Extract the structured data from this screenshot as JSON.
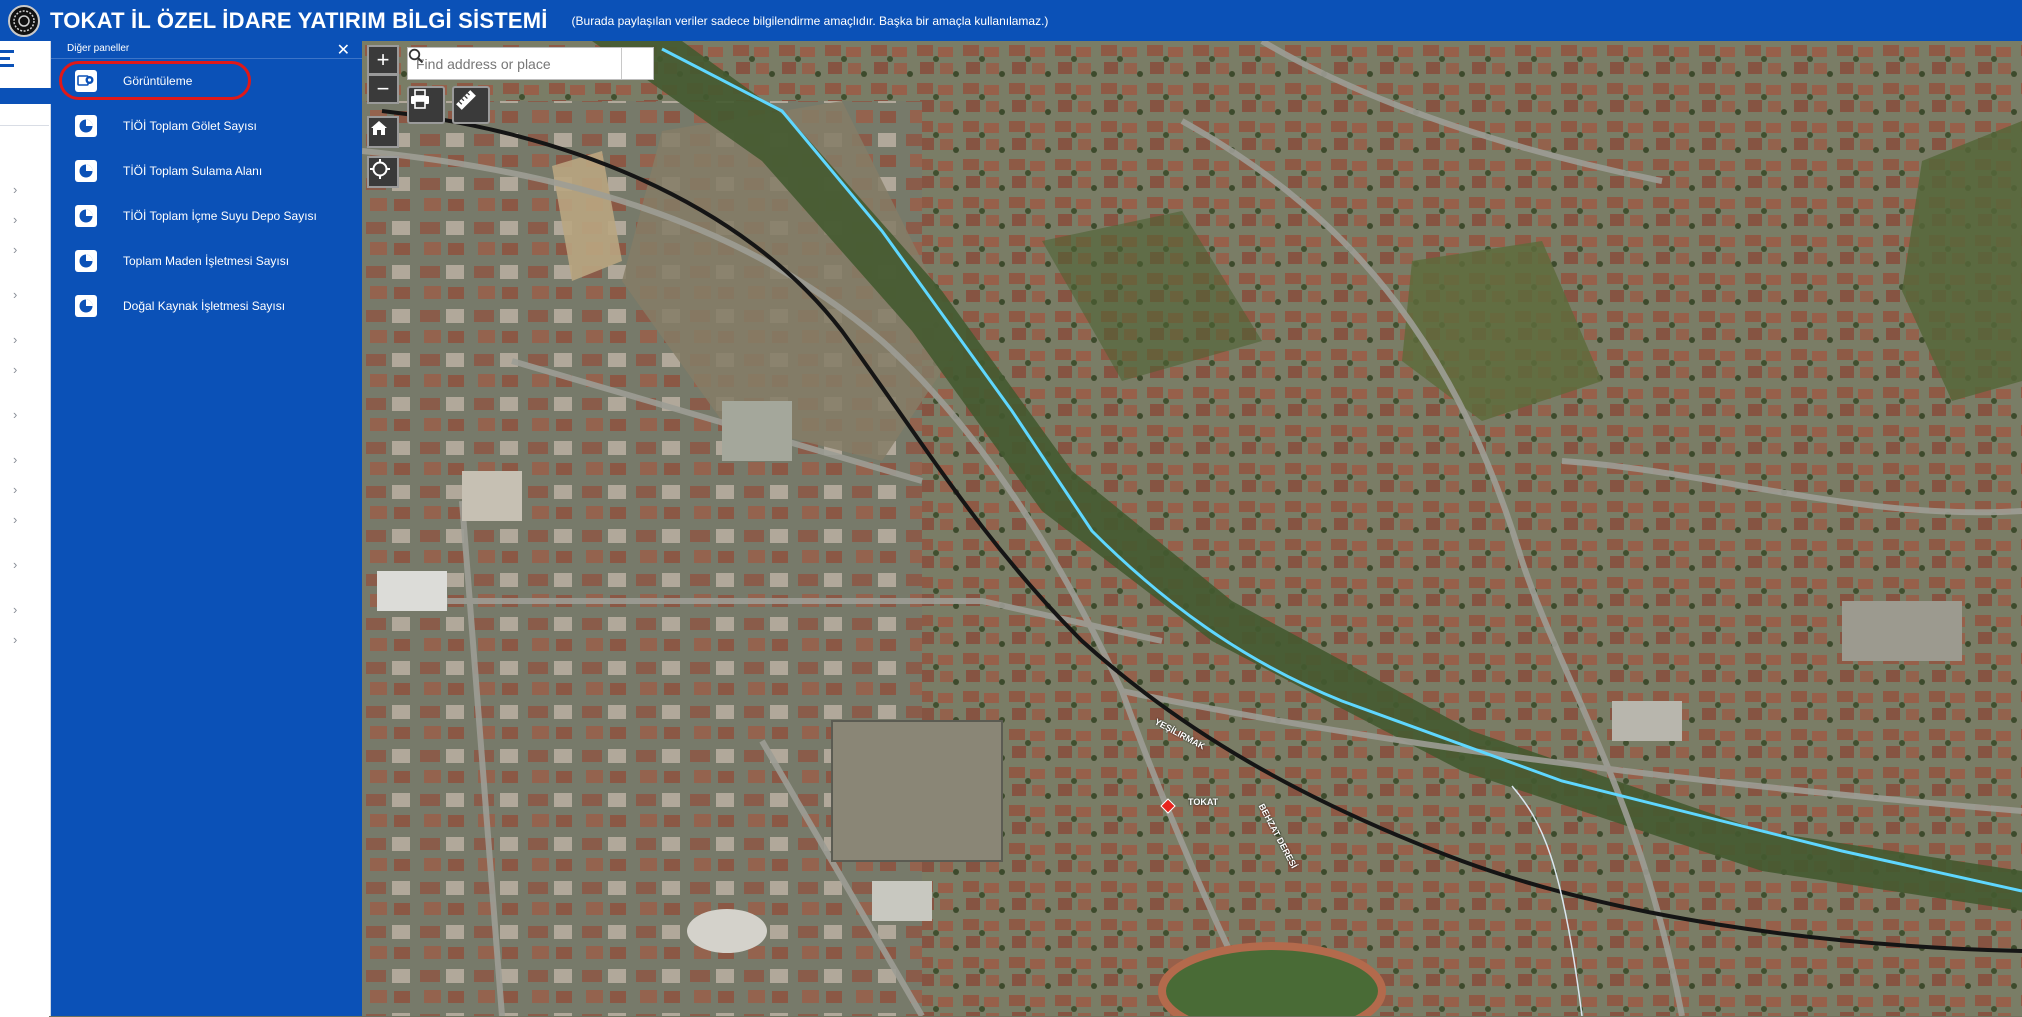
{
  "header": {
    "title": "TOKAT İL ÖZEL İDARE YATIRIM BİLGİ SİSTEMİ",
    "subtitle": "(Burada paylaşılan veriler sadece bilgilendirme amaçlıdır. Başka bir amaçla kullanılamaz.)",
    "logo_icon": "seal-logo"
  },
  "panel": {
    "title": "Diğer paneller",
    "close_icon": "close-icon",
    "items": [
      {
        "label": "Görüntüleme",
        "icon": "viewer-icon",
        "highlighted": true
      },
      {
        "label": "TİÖİ Toplam Gölet Sayısı",
        "icon": "pie-chart-icon"
      },
      {
        "label": "TİÖİ Toplam Sulama Alanı",
        "icon": "pie-chart-icon"
      },
      {
        "label": "TİÖİ Toplam İçme Suyu Depo Sayısı",
        "icon": "pie-chart-icon"
      },
      {
        "label": "Toplam Maden İşletmesi Sayısı",
        "icon": "pie-chart-icon"
      },
      {
        "label": "Doğal Kaynak İşletmesi Sayısı",
        "icon": "pie-chart-icon"
      }
    ],
    "highlight_color": "#e01818"
  },
  "map": {
    "search_placeholder": "Find address or place",
    "zoom_in": "+",
    "zoom_out": "−",
    "labels": {
      "river": "YEŞİLIRMAK",
      "stream": "BEHZAT DERESİ",
      "city": "TOKAT"
    }
  },
  "colors": {
    "brand_blue": "#0b51b7",
    "river_line": "#5fd7ff",
    "rail_line": "#151515"
  }
}
